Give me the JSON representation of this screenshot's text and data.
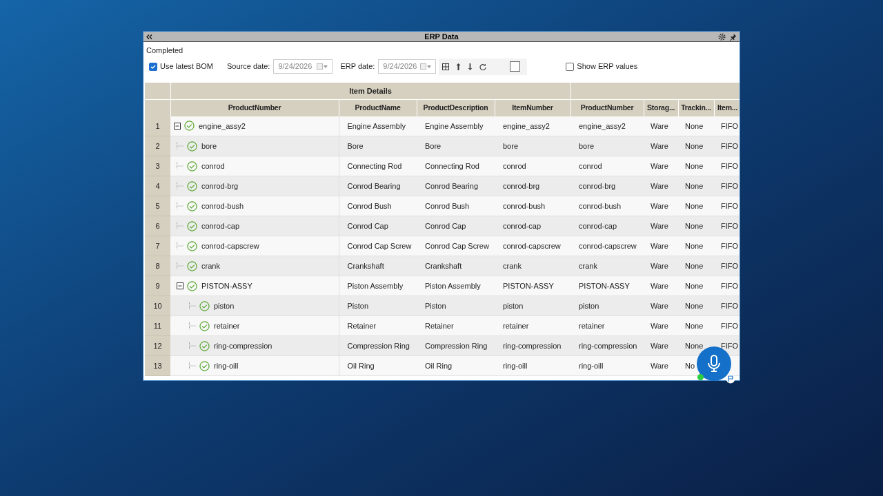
{
  "window": {
    "title": "ERP Data"
  },
  "status": "Completed",
  "toolbar": {
    "use_latest_bom": {
      "label": "Use latest BOM",
      "checked": true
    },
    "source_date": {
      "label": "Source date:",
      "value": "9/24/2026"
    },
    "erp_date": {
      "label": "ERP date:",
      "value": "9/24/2026"
    },
    "toolbar_checkbox": {
      "checked": false
    },
    "show_erp_values": {
      "label": "Show ERP values",
      "checked": false
    }
  },
  "table": {
    "group_header": "Item Details",
    "columns": [
      "ProductNumber",
      "ProductName",
      "ProductDescription",
      "ItemNumber",
      "ProductNumber",
      "Storag...",
      "Trackin...",
      "Item..."
    ],
    "rows": [
      {
        "index": "1",
        "expanded": true,
        "cells": [
          "engine_assy2",
          "Engine Assembly",
          "Engine Assembly",
          "engine_assy2",
          "engine_assy2",
          "Ware",
          "None",
          "FIFO"
        ],
        "children": [
          {
            "index": "2",
            "cells": [
              "bore",
              "Bore",
              "Bore",
              "bore",
              "bore",
              "Ware",
              "None",
              "FIFO"
            ]
          },
          {
            "index": "3",
            "cells": [
              "conrod",
              "Connecting Rod",
              "Connecting Rod",
              "conrod",
              "conrod",
              "Ware",
              "None",
              "FIFO"
            ]
          },
          {
            "index": "4",
            "cells": [
              "conrod-brg",
              "Conrod Bearing",
              "Conrod Bearing",
              "conrod-brg",
              "conrod-brg",
              "Ware",
              "None",
              "FIFO"
            ]
          },
          {
            "index": "5",
            "cells": [
              "conrod-bush",
              "Conrod Bush",
              "Conrod Bush",
              "conrod-bush",
              "conrod-bush",
              "Ware",
              "None",
              "FIFO"
            ]
          },
          {
            "index": "6",
            "cells": [
              "conrod-cap",
              "Conrod Cap",
              "Conrod Cap",
              "conrod-cap",
              "conrod-cap",
              "Ware",
              "None",
              "FIFO"
            ]
          },
          {
            "index": "7",
            "cells": [
              "conrod-capscrew",
              "Conrod Cap Screw",
              "Conrod Cap Screw",
              "conrod-capscrew",
              "conrod-capscrew",
              "Ware",
              "None",
              "FIFO"
            ]
          },
          {
            "index": "8",
            "cells": [
              "crank",
              "Crankshaft",
              "Crankshaft",
              "crank",
              "crank",
              "Ware",
              "None",
              "FIFO"
            ]
          },
          {
            "index": "9",
            "expanded": true,
            "cells": [
              "PISTON-ASSY",
              "Piston Assembly",
              "Piston Assembly",
              "PISTON-ASSY",
              "PISTON-ASSY",
              "Ware",
              "None",
              "FIFO"
            ],
            "children": [
              {
                "index": "10",
                "cells": [
                  "piston",
                  "Piston",
                  "Piston",
                  "piston",
                  "piston",
                  "Ware",
                  "None",
                  "FIFO"
                ]
              },
              {
                "index": "11",
                "cells": [
                  "retainer",
                  "Retainer",
                  "Retainer",
                  "retainer",
                  "retainer",
                  "Ware",
                  "None",
                  "FIFO"
                ]
              },
              {
                "index": "12",
                "cells": [
                  "ring-compression",
                  "Compression Ring",
                  "Compression Ring",
                  "ring-compression",
                  "ring-compression",
                  "Ware",
                  "None",
                  "FIFO"
                ]
              },
              {
                "index": "13",
                "cells": [
                  "ring-oill",
                  "Oil Ring",
                  "Oil Ring",
                  "ring-oill",
                  "ring-oill",
                  "Ware",
                  "No",
                  ""
                ]
              }
            ]
          }
        ]
      }
    ]
  }
}
